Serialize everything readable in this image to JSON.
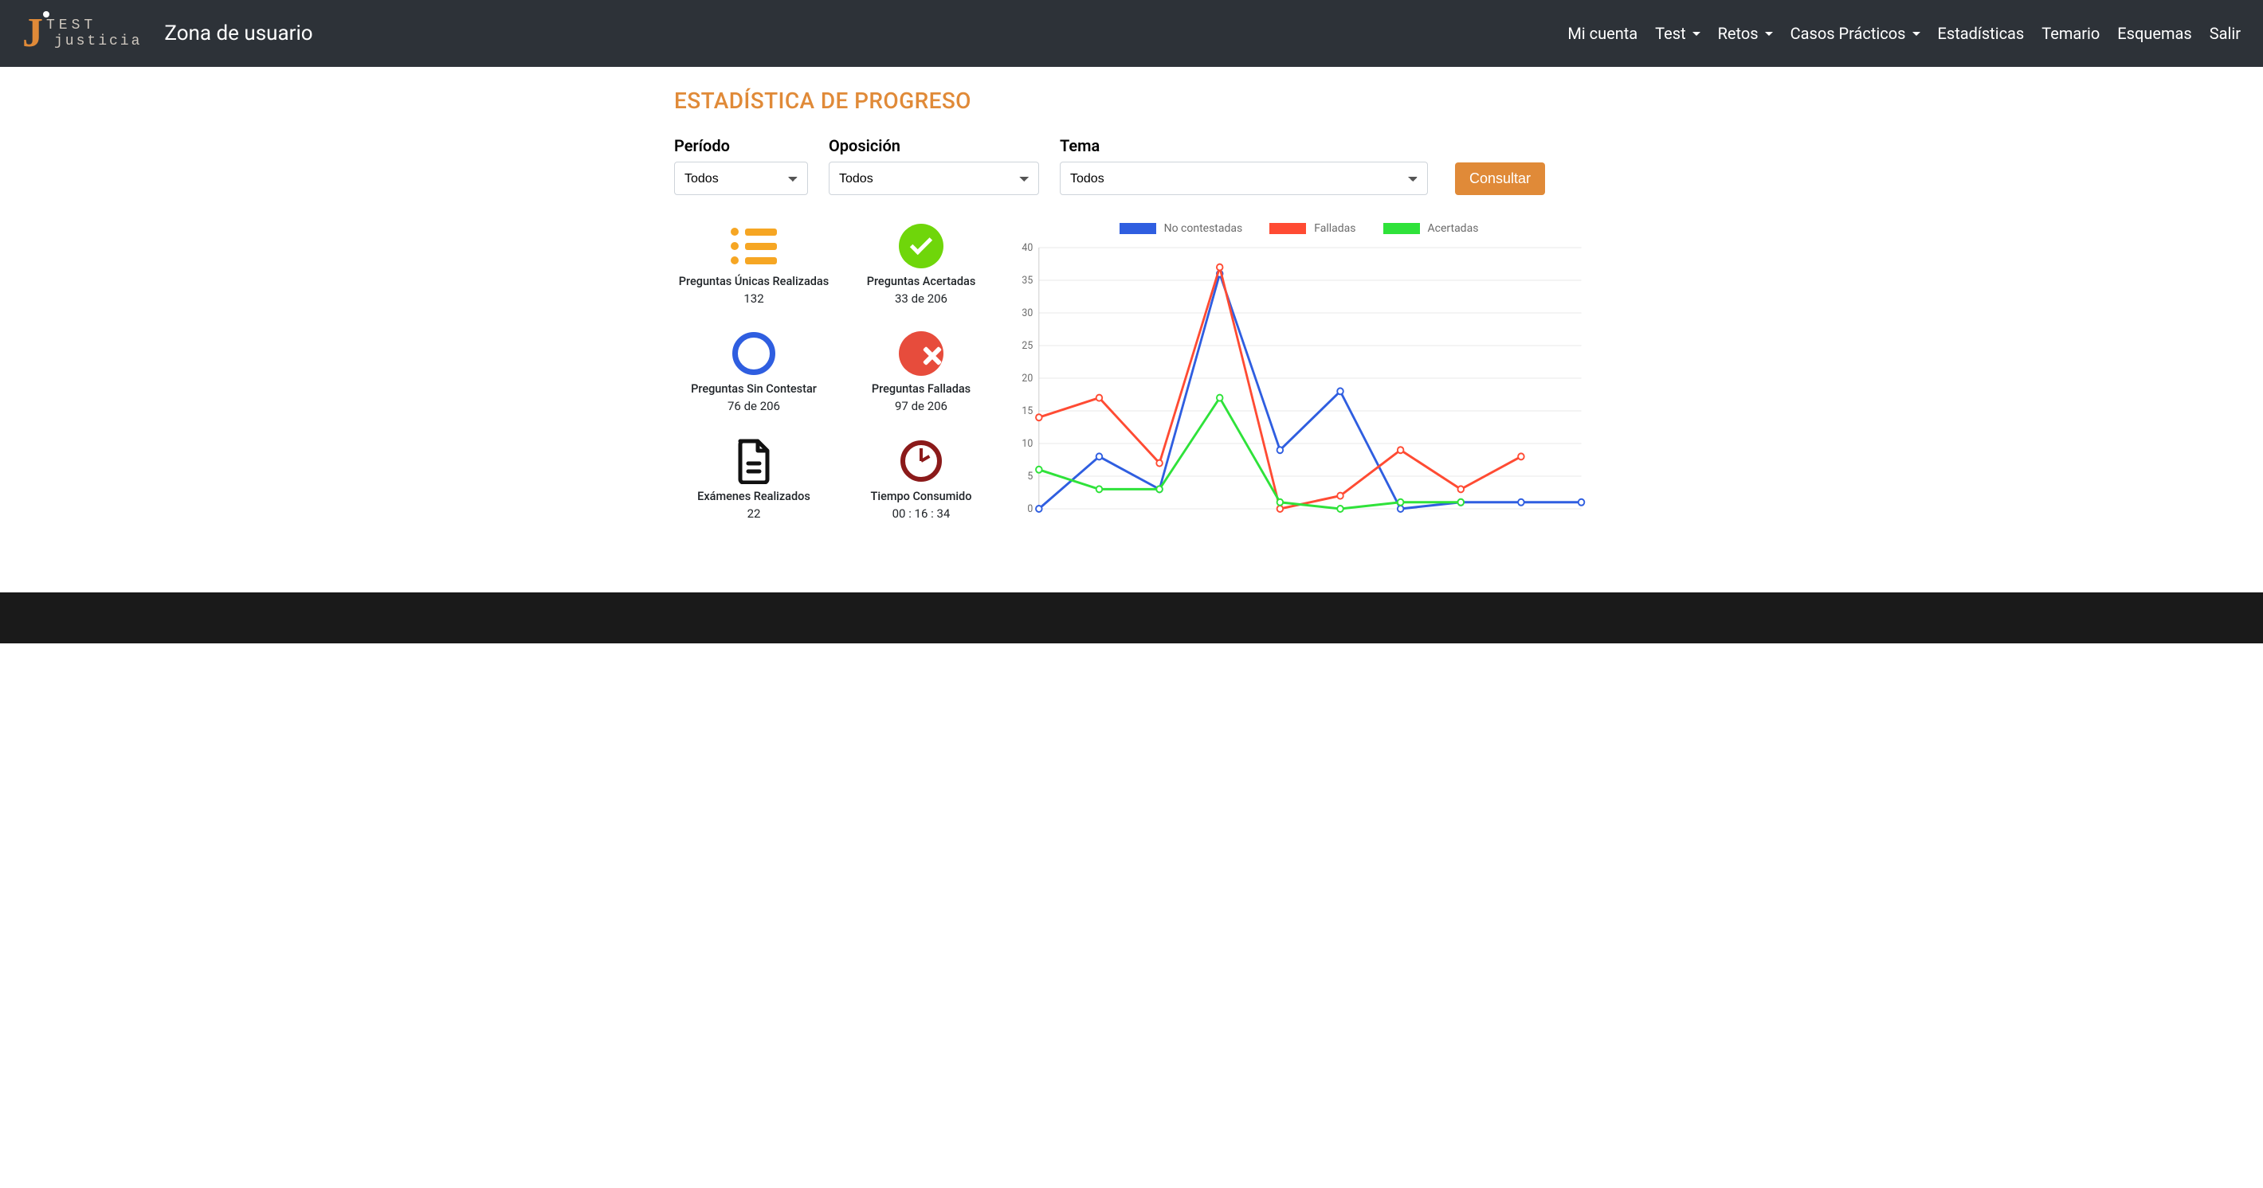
{
  "brand": {
    "line1": "TEST",
    "line2": "justicia",
    "title": "Zona de usuario"
  },
  "nav": {
    "mi_cuenta": "Mi cuenta",
    "test": "Test",
    "retos": "Retos",
    "casos": "Casos Prácticos",
    "estadisticas": "Estadísticas",
    "temario": "Temario",
    "esquemas": "Esquemas",
    "salir": "Salir"
  },
  "page": {
    "title": "ESTADÍSTICA DE PROGRESO"
  },
  "filters": {
    "periodo_label": "Período",
    "periodo_value": "Todos",
    "oposicion_label": "Oposición",
    "oposicion_value": "Todos",
    "tema_label": "Tema",
    "tema_value": "Todos",
    "consultar_label": "Consultar"
  },
  "stats": {
    "unicas": {
      "title": "Preguntas Únicas Realizadas",
      "value": "132"
    },
    "acertadas": {
      "title": "Preguntas Acertadas",
      "value": "33 de 206"
    },
    "sin_contestar": {
      "title": "Preguntas Sin Contestar",
      "value": "76 de 206"
    },
    "falladas": {
      "title": "Preguntas Falladas",
      "value": "97 de 206"
    },
    "examenes": {
      "title": "Exámenes Realizados",
      "value": "22"
    },
    "tiempo": {
      "title": "Tiempo Consumido",
      "value": "00 : 16 : 34"
    }
  },
  "chart_legend": {
    "no_contestadas": "No contestadas",
    "falladas": "Falladas",
    "acertadas": "Acertadas"
  },
  "chart_data": {
    "type": "line",
    "ylim": [
      0,
      40
    ],
    "yticks": [
      0,
      5,
      10,
      15,
      20,
      25,
      30,
      35,
      40
    ],
    "x": [
      1,
      2,
      3,
      4,
      5,
      6,
      7,
      8,
      9,
      10
    ],
    "series": [
      {
        "name": "No contestadas",
        "color": "#2f5ee0",
        "values": [
          0,
          8,
          3,
          36,
          9,
          18,
          0,
          1,
          1,
          1
        ]
      },
      {
        "name": "Falladas",
        "color": "#ff4b33",
        "values": [
          14,
          17,
          7,
          37,
          0,
          2,
          9,
          3,
          8,
          null
        ]
      },
      {
        "name": "Acertadas",
        "color": "#2fe23a",
        "values": [
          6,
          3,
          3,
          17,
          1,
          0,
          1,
          1,
          null,
          null
        ]
      }
    ]
  },
  "colors": {
    "accent": "#e08a38",
    "blue": "#2f5ee0",
    "red": "#ff4b33",
    "green": "#2fe23a"
  }
}
